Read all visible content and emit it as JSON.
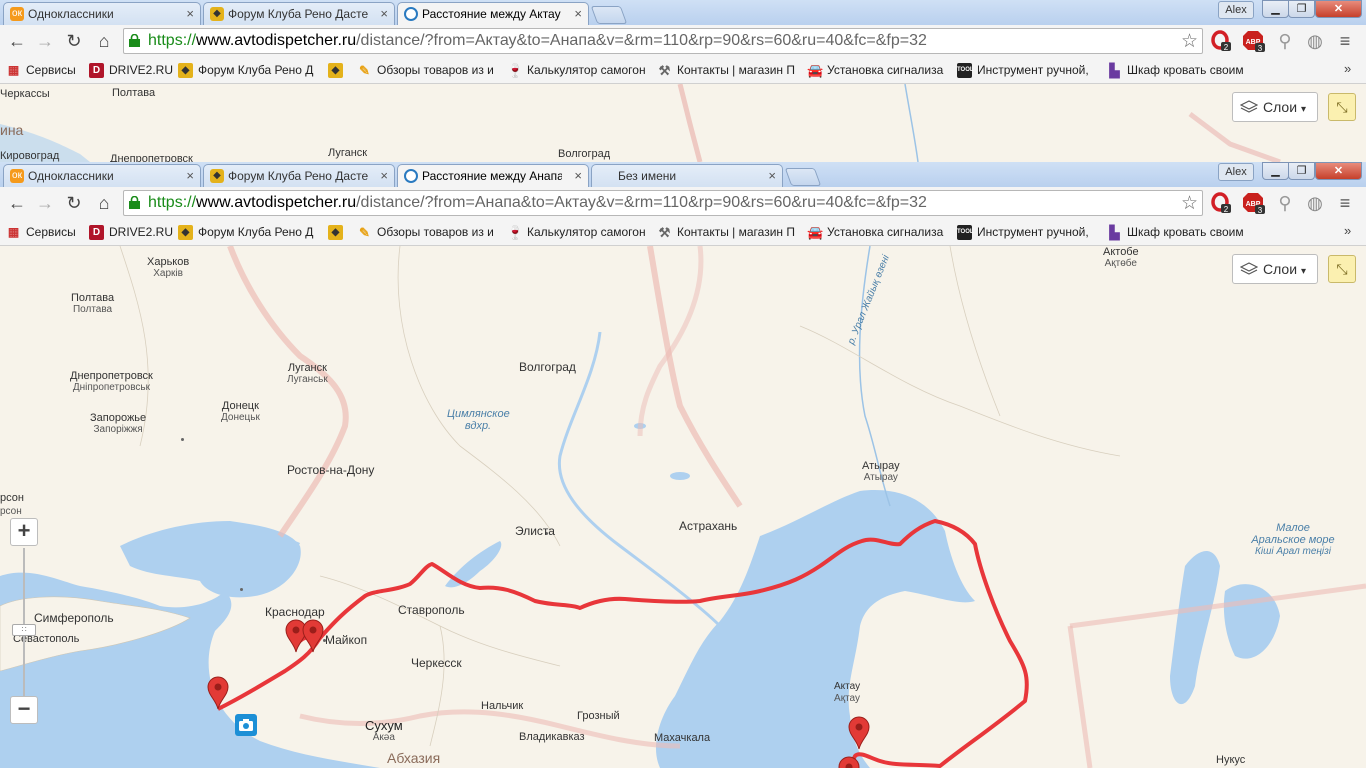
{
  "windows": [
    {
      "tabs": [
        {
          "label": "Одноклассники",
          "icon": "odnoklassniki-icon",
          "active": false
        },
        {
          "label": "Форум Клуба Рено Дастер",
          "icon": "renault-icon",
          "active": false
        },
        {
          "label": "Расстояние между Актау",
          "icon": "avtodispetcher-icon",
          "active": true
        }
      ],
      "user": "Alex",
      "url": {
        "scheme": "https://",
        "host": "www.avtodispetcher.ru",
        "path": "/distance/?from=Актау&to=Анапа&v=&rm=110&rp=90&rs=60&ru=40&fc=&fp=32"
      },
      "map_labels": {
        "kherson": "Черкассы",
        "poltava": "Полтава",
        "lugansk": "Луганск",
        "volgograd": "Волгоград",
        "kirovograd": "Кировоград",
        "dnepr": "Днепропетровск",
        "ukraine": "ина"
      }
    },
    {
      "tabs": [
        {
          "label": "Одноклассники",
          "icon": "odnoklassniki-icon",
          "active": false
        },
        {
          "label": "Форум Клуба Рено Дастер",
          "icon": "renault-icon",
          "active": false
        },
        {
          "label": "Расстояние между Анапа",
          "icon": "avtodispetcher-icon",
          "active": true
        },
        {
          "label": "Без имени",
          "icon": "",
          "active": false
        }
      ],
      "user": "Alex",
      "url": {
        "scheme": "https://",
        "host": "www.avtodispetcher.ru",
        "path": "/distance/?from=Анапа&to=Актау&v=&rm=110&rp=90&rs=60&ru=40&fc=&fp=32"
      }
    }
  ],
  "extensions": {
    "opera_badge": "2",
    "adblock_badge": "3",
    "adblock_label": "ABP"
  },
  "bookmarks": [
    {
      "label": "Сервисы",
      "icon": "apps-icon"
    },
    {
      "label": "DRIVE2.RU",
      "icon": "drive2-icon"
    },
    {
      "label": "Форум Клуба Рено Д",
      "icon": "renault-icon"
    },
    {
      "label": "",
      "icon": "renault-icon"
    },
    {
      "label": "Обзоры товаров из и",
      "icon": "pencil-icon"
    },
    {
      "label": "Калькулятор самогон",
      "icon": "goblet-icon"
    },
    {
      "label": "Контакты | магазин П",
      "icon": "tools-icon"
    },
    {
      "label": "Установка сигнализа",
      "icon": "car-icon"
    },
    {
      "label": "Инструмент ручной,",
      "icon": "tool-icon"
    },
    {
      "label": "Шкаф кровать своим",
      "icon": "furniture-icon"
    }
  ],
  "map": {
    "layers_label": "Слои",
    "zoom_in": "+",
    "zoom_out": "−",
    "route_color": "#e8363a",
    "labels": {
      "kharkov": {
        "ru": "Харьков",
        "ua": "Харків"
      },
      "poltava": {
        "ru": "Полтава",
        "ua": "Полтава"
      },
      "dnepr": {
        "ru": "Днепропетровск",
        "ua": "Дніпропетровськ"
      },
      "zaporozhye": {
        "ru": "Запорожье",
        "ua": "Запоріжжя"
      },
      "donetsk": {
        "ru": "Донецк",
        "ua": "Донецьк"
      },
      "lugansk": {
        "ru": "Луганск",
        "ua": "Луганськ"
      },
      "rostov": "Ростов-на-Дону",
      "volgograd": "Волгоград",
      "tsimlyansk": "Цимлянское вдхр.",
      "elista": "Элиста",
      "astrakhan": "Астрахань",
      "atyrau": {
        "ru": "Атырау",
        "ua": "Атырау"
      },
      "aktobe": {
        "ru": "Актобе",
        "ua": "Ақтөбе"
      },
      "ural": "р. Урал Жайық өзені",
      "krasnodar": "Краснодар",
      "stavropol": "Ставрополь",
      "maykop": "Майкоп",
      "cherkessk": "Черкесск",
      "simferopol": "Симферополь",
      "sevastopol": "Севастополь",
      "sukhum": {
        "ru": "Сухум",
        "ab": "Акәа"
      },
      "abkhazia": "Абхазия",
      "nalchik": "Нальчик",
      "grozny": "Грозный",
      "vladikavkaz": "Владикавказ",
      "makhachkala": "Махачкала",
      "aktau": {
        "ru": "Актау",
        "kz": "Ақтау"
      },
      "aral": {
        "ru": "Малое Аральское море",
        "kz": "Кіші Арал теңізі"
      },
      "nukus": "Нукус",
      "kherson": "рсон",
      "left_edge": "рсон"
    }
  }
}
